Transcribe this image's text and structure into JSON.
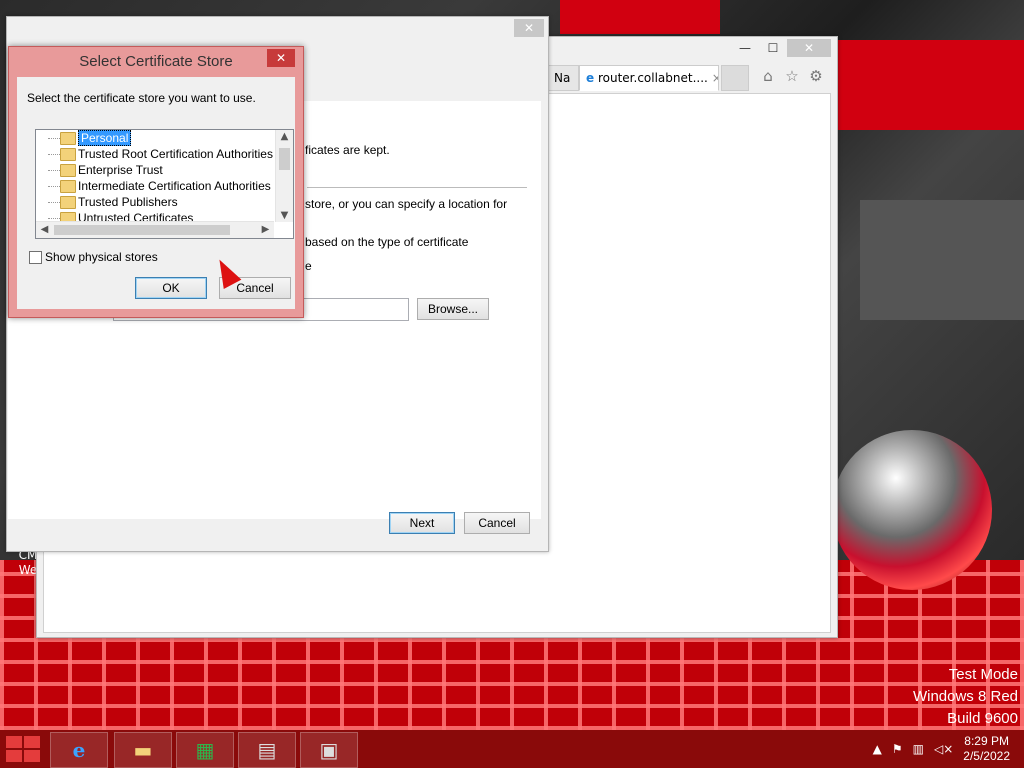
{
  "desktop": {
    "watermark": [
      "Test Mode",
      "Windows 8 Red",
      "Build 9600"
    ],
    "icon_label_1": "CM",
    "icon_label_2": "We"
  },
  "browser": {
    "tabs": [
      {
        "label": "Na"
      },
      {
        "label": "router.collabnet...."
      }
    ],
    "close_glyph": "×",
    "window_buttons": [
      "—",
      "☐",
      "✕"
    ]
  },
  "wizard": {
    "close_glyph": "✕",
    "text_1": "ficates are kept.",
    "text_2": "store, or you can specify a location for",
    "text_3": "based on the type of certificate",
    "text_4": "e",
    "browse_label": "Browse...",
    "next_label": "Next",
    "cancel_label": "Cancel"
  },
  "dialog": {
    "title": "Select Certificate Store",
    "close_glyph": "✕",
    "prompt": "Select the certificate store you want to use.",
    "stores": [
      "Personal",
      "Trusted Root Certification Authorities",
      "Enterprise Trust",
      "Intermediate Certification Authorities",
      "Trusted Publishers",
      "Untrusted Certificates"
    ],
    "selected_index": 0,
    "show_physical_label": "Show physical stores",
    "ok_label": "OK",
    "cancel_label": "Cancel"
  },
  "taskbar": {
    "time": "8:29 PM",
    "date": "2/5/2022"
  },
  "colors": {
    "accent_red": "#c00008",
    "selection_blue": "#3399ff"
  }
}
